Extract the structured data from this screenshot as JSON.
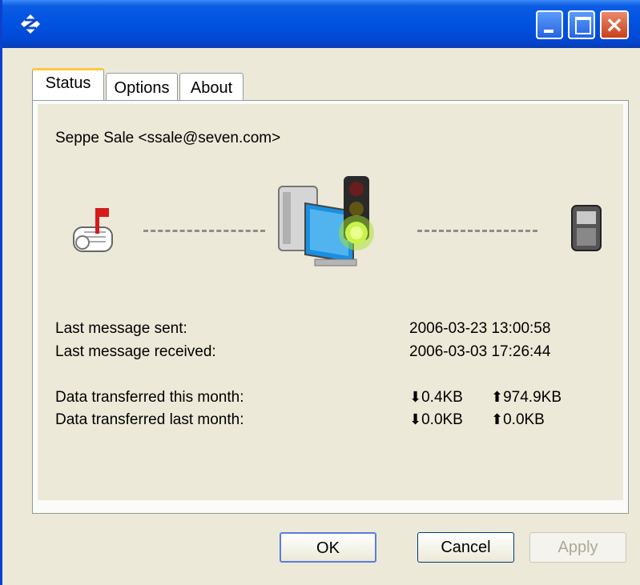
{
  "window": {
    "title": "",
    "buttons": {
      "minimize": "minimize",
      "maximize": "maximize",
      "close": "close"
    }
  },
  "tabs": [
    {
      "label": "Status",
      "active": true
    },
    {
      "label": "Options",
      "active": false
    },
    {
      "label": "About",
      "active": false
    }
  ],
  "status": {
    "account": "Seppe Sale <ssale@seven.com>",
    "icons": [
      "mailbox-icon",
      "computer-traffic-light-icon",
      "mobile-device-icon"
    ],
    "rows": [
      {
        "label": "Last message sent:",
        "value": "2006-03-23 13:00:58"
      },
      {
        "label": "Last message received:",
        "value": "2006-03-03 17:26:44"
      }
    ],
    "transfer": [
      {
        "label": "Data transferred this month:",
        "down": "0.4KB",
        "up": "974.9KB"
      },
      {
        "label": "Data transferred last month:",
        "down": "0.0KB",
        "up": "0.0KB"
      }
    ]
  },
  "footer": {
    "ok": "OK",
    "cancel": "Cancel",
    "apply": "Apply"
  },
  "colors": {
    "titlebar": "#0153e2",
    "panel": "#ece9d8",
    "close": "#c8401c",
    "traffic_light_green": "#a4e22a"
  }
}
